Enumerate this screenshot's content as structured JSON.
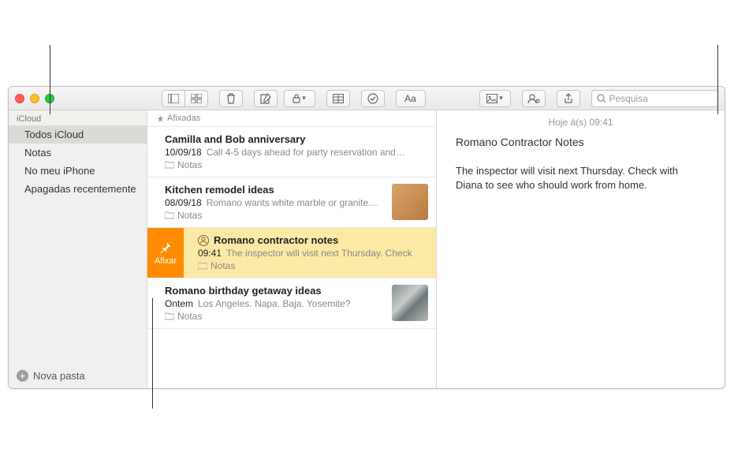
{
  "toolbar": {
    "search_placeholder": "Pesquisa"
  },
  "sidebar": {
    "account_header": "iCloud",
    "items": [
      {
        "label": "Todos iCloud",
        "selected": true
      },
      {
        "label": "Notas",
        "selected": false
      },
      {
        "label": "No meu iPhone",
        "selected": false
      },
      {
        "label": "Apagadas recentemente",
        "selected": false
      }
    ],
    "new_folder_label": "Nova pasta"
  },
  "notelist": {
    "pinned_header": "Afixadas",
    "swipe_pin_label": "Afixar",
    "notes": [
      {
        "title": "Camilla and Bob anniversary",
        "date": "10/09/18",
        "preview": "Call 4-5 days ahead for party reservation and…",
        "folder": "Notas",
        "thumb": null,
        "selected": false,
        "shared": false
      },
      {
        "title": "Kitchen remodel ideas",
        "date": "08/09/18",
        "preview": "Romano wants white marble or granite…",
        "folder": "Notas",
        "thumb": "wood",
        "selected": false,
        "shared": false
      },
      {
        "title": "Romano contractor notes",
        "date": "09:41",
        "preview": "The inspector will visit next Thursday. Check",
        "folder": "Notas",
        "thumb": null,
        "selected": true,
        "shared": true
      },
      {
        "title": "Romano birthday getaway ideas",
        "date": "Ontem",
        "preview": "Los Angeles. Napa. Baja. Yosemite?",
        "folder": "Notas",
        "thumb": "rocks",
        "selected": false,
        "shared": false
      }
    ]
  },
  "editor": {
    "timestamp": "Hoje à(s) 09:41",
    "title": "Romano Contractor Notes",
    "body": "The inspector will visit next Thursday. Check with Diana to see who should work from home."
  }
}
